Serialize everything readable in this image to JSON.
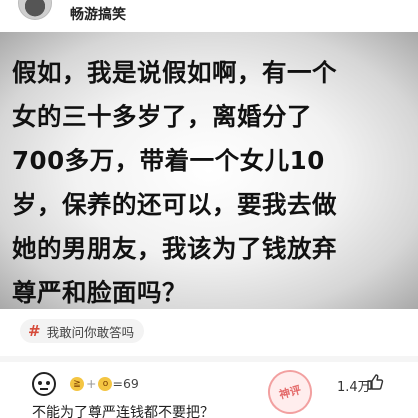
{
  "post": {
    "author": "畅游搞笑"
  },
  "meme": {
    "lines": [
      "假如，我是说假如啊，有一个",
      "女的三十多岁了，离婚分了",
      "700多万，带着一个女儿10",
      "岁，保养的还可以，要我去做",
      "她的男朋友，我该为了钱放弃",
      "尊严和脸面吗？"
    ]
  },
  "topic": {
    "icon": "hash-icon",
    "label": "我敢问你敢答吗"
  },
  "comment": {
    "reaction_text": "=69",
    "likes": "1.4万",
    "stamp_text": "神评",
    "text": "不能为了尊严连钱都不要把？"
  },
  "colors": {
    "hash": "#d64b3a",
    "stamp": "#e46a6a"
  }
}
